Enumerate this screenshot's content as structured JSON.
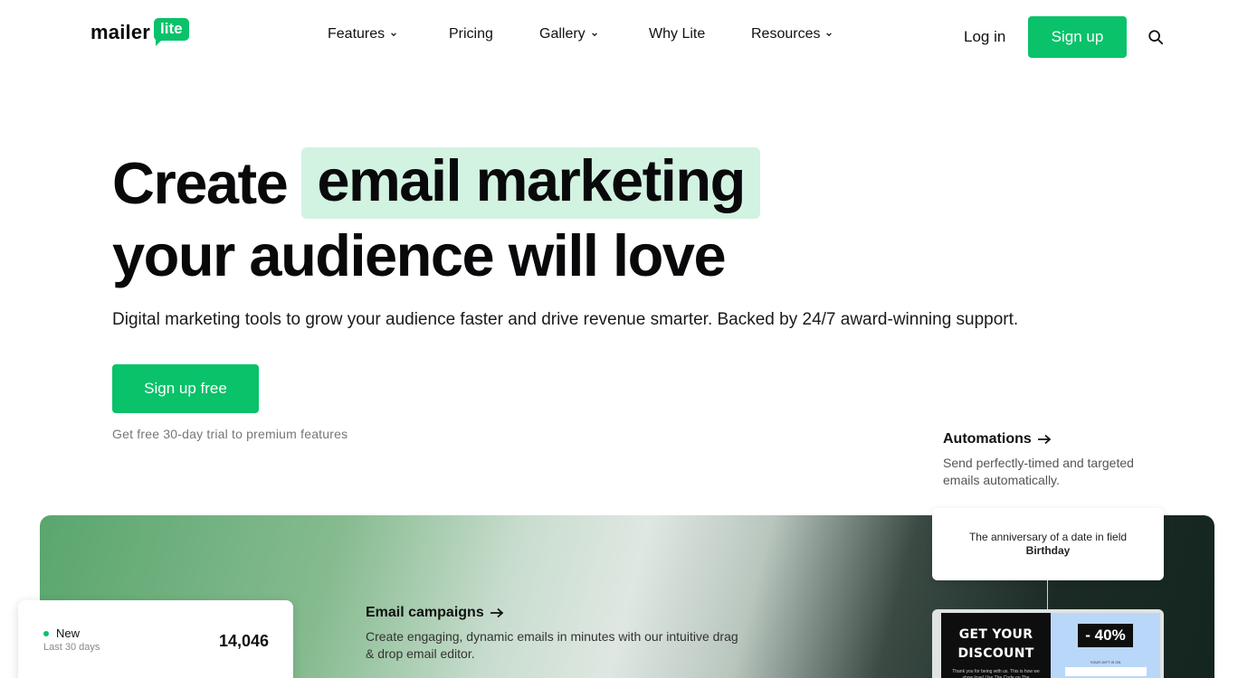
{
  "brand": {
    "word": "mailer",
    "badge": "lite",
    "accent": "#09c269"
  },
  "nav": {
    "items": [
      {
        "label": "Features",
        "dropdown": true
      },
      {
        "label": "Pricing",
        "dropdown": false
      },
      {
        "label": "Gallery",
        "dropdown": true
      },
      {
        "label": "Why Lite",
        "dropdown": false
      },
      {
        "label": "Resources",
        "dropdown": true
      }
    ],
    "login": "Log in",
    "signup": "Sign up",
    "search_icon": "search-icon"
  },
  "hero": {
    "line1_start": "Create",
    "line1_highlight": "email marketing",
    "line2": "your audience will love",
    "subtitle": "Digital marketing tools to grow your audience faster and drive revenue smarter. Backed by 24/7 award-winning support.",
    "cta": "Sign up free",
    "trial_note": "Get free 30-day trial to premium features",
    "highlight_color": "#d2f3e1"
  },
  "automations": {
    "title": "Automations",
    "desc": "Send perfectly-timed and targeted emails automatically."
  },
  "campaigns": {
    "title": "Email campaigns",
    "desc": "Create engaging, dynamic emails in minutes with our intuitive drag & drop email editor."
  },
  "stat": {
    "label": "New",
    "sub": "Last 30 days",
    "value": "14,046"
  },
  "trigger": {
    "text": "The anniversary of a date in field",
    "field": "Birthday"
  },
  "email_preview": {
    "left_line1": "GET YOUR",
    "left_line2": "DISCOUNT",
    "left_small": "Thank you for being with us. This is how we show love! Use The Code on The",
    "right_discount": "- 40%",
    "right_small": "YOUR GIFT IS ON"
  }
}
